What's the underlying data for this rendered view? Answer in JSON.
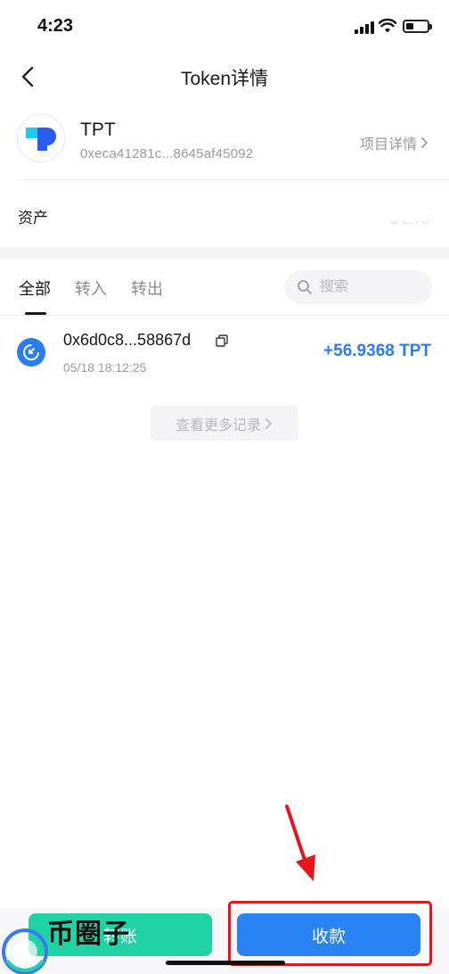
{
  "status_bar": {
    "time": "4:23"
  },
  "header": {
    "title": "Token详情"
  },
  "token": {
    "symbol": "TPT",
    "address": "0xeca41281c...8645af45092",
    "project_link": "项目详情"
  },
  "assets": {
    "label": "资产",
    "value": "$ 2.73"
  },
  "tabs": [
    {
      "label": "全部",
      "active": true
    },
    {
      "label": "转入",
      "active": false
    },
    {
      "label": "转出",
      "active": false
    }
  ],
  "search": {
    "placeholder": "搜索"
  },
  "transactions": [
    {
      "hash": "0x6d0c8...58867d",
      "time": "05/18 18:12:25",
      "amount": "+56.9368 TPT"
    }
  ],
  "more_records": "查看更多记录",
  "actions": {
    "transfer": "转账",
    "receive": "收款"
  },
  "watermark": "币圈子",
  "colors": {
    "primary_blue": "#2a83f3",
    "transfer_green": "#1fd3a5",
    "amount_blue": "#2a7cf0",
    "annotation_red": "#e8141b"
  }
}
